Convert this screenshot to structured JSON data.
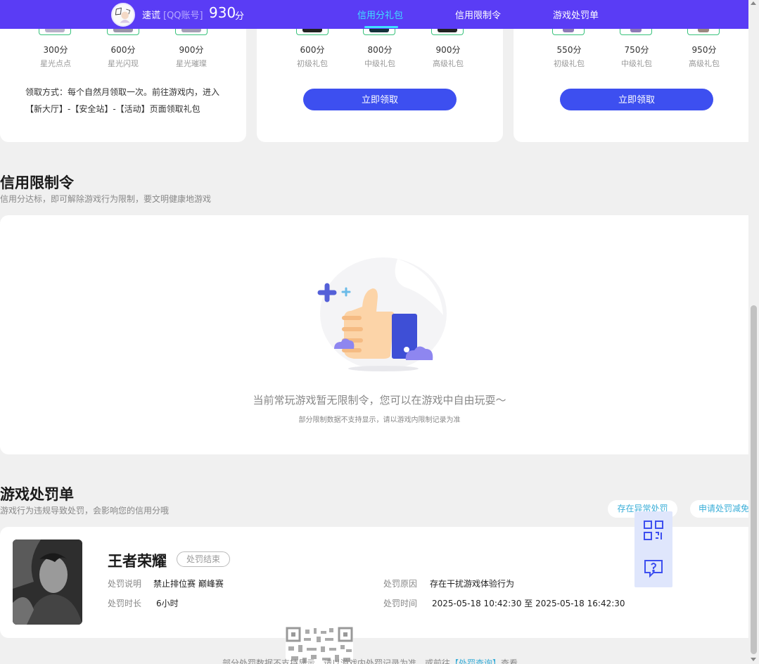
{
  "header": {
    "user_name": "速谎",
    "account_type": "[QQ账号]",
    "score": "930",
    "score_unit": "分",
    "tabs": [
      {
        "label": "信用分礼包",
        "active": true
      },
      {
        "label": "信用限制令",
        "active": false
      },
      {
        "label": "游戏处罚单",
        "active": false
      }
    ]
  },
  "gift_cards": [
    {
      "items": [
        {
          "points": "300分",
          "name": "星光点点"
        },
        {
          "points": "600分",
          "name": "星光闪现"
        },
        {
          "points": "900分",
          "name": "星光璀璨"
        }
      ],
      "claim_text": "领取方式：每个自然月领取一次。前往游戏内，进入【新大厅】-【安全站】-【活动】页面领取礼包"
    },
    {
      "items": [
        {
          "points": "600分",
          "name": "初级礼包"
        },
        {
          "points": "800分",
          "name": "中级礼包"
        },
        {
          "points": "900分",
          "name": "高级礼包"
        }
      ],
      "button": "立即领取"
    },
    {
      "items": [
        {
          "points": "550分",
          "name": "初级礼包"
        },
        {
          "points": "750分",
          "name": "中级礼包"
        },
        {
          "points": "950分",
          "name": "高级礼包"
        }
      ],
      "button": "立即领取"
    }
  ],
  "restriction": {
    "title": "信用限制令",
    "subtitle": "信用分达标，即可解除游戏行为限制，要文明健康地游戏",
    "empty_main": "当前常玩游戏暂无限制令，您可以在游戏中自由玩耍～",
    "empty_sub": "部分限制数据不支持显示，请以游戏内限制记录为准"
  },
  "penalty": {
    "title": "游戏处罚单",
    "subtitle": "游戏行为违规导致处罚，会影响您的信用分哦",
    "btn_abnormal": "存在异常处罚",
    "btn_appeal": "申请处罚减免",
    "record": {
      "game": "王者荣耀",
      "status": "处罚结束",
      "desc_label": "处罚说明",
      "desc_value": "禁止排位赛 巅峰赛",
      "reason_label": "处罚原因",
      "reason_value": "存在干扰游戏体验行为",
      "duration_label": "处罚时长",
      "duration_value": "6小时",
      "time_label": "处罚时间",
      "time_value": "2025-05-18 10:42:30 至 2025-05-18 16:42:30"
    },
    "footer_note_pre": "部分处罚数据不支持显示，请以游戏内处罚记录为准，或前往",
    "footer_link": "【处罚查询】",
    "footer_note_post": "查看"
  },
  "colors": {
    "header_bg": "#5a3cf5",
    "active_tab": "#3fe0ff",
    "primary_button": "#3d4ff0",
    "link": "#3aaed8"
  }
}
